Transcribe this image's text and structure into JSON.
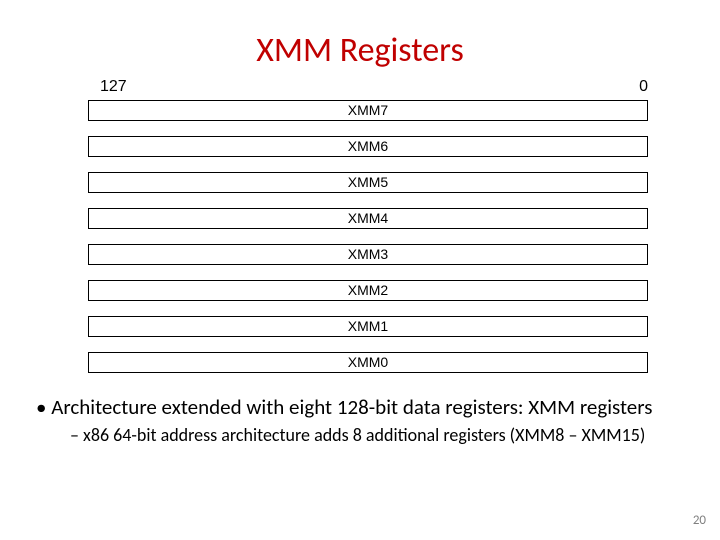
{
  "title": "XMM Registers",
  "bits": {
    "high": "127",
    "low": "0"
  },
  "registers": [
    "XMM7",
    "XMM6",
    "XMM5",
    "XMM4",
    "XMM3",
    "XMM2",
    "XMM1",
    "XMM0"
  ],
  "bullets": {
    "main": "Architecture extended with eight 128-bit data registers: XMM registers",
    "sub": "x86 64-bit address architecture adds 8 additional registers (XMM8 – XMM15)"
  },
  "pageNumber": "20"
}
